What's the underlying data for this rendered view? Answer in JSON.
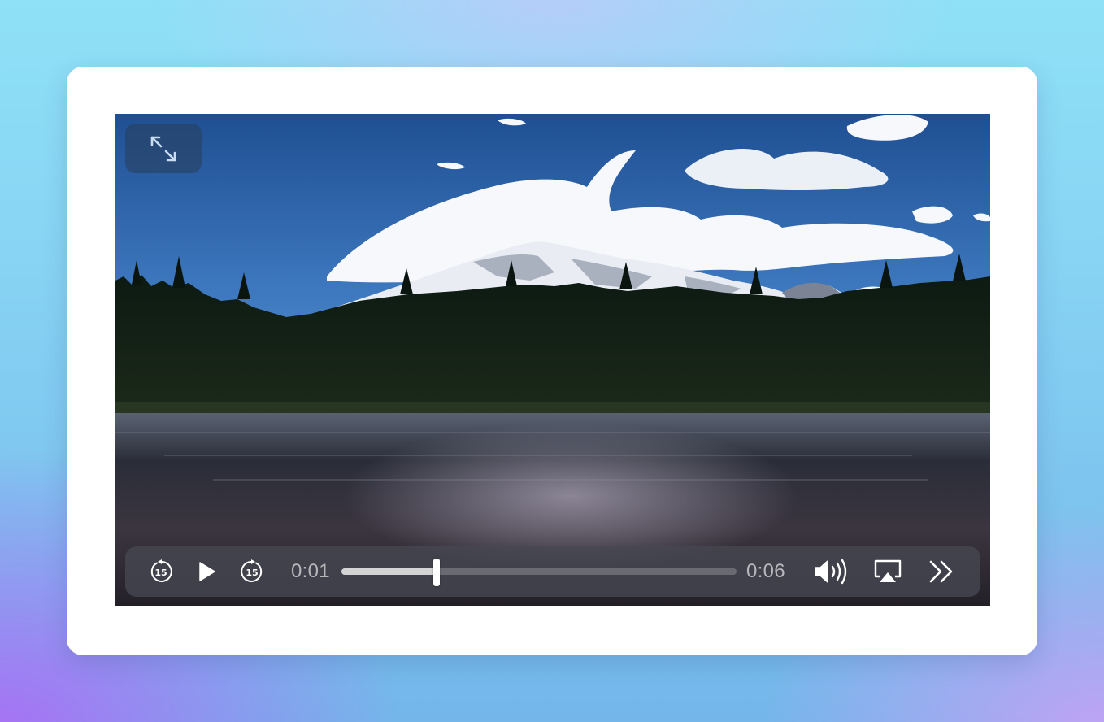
{
  "player": {
    "current_time": "0:01",
    "duration": "0:06",
    "progress_fraction": 0.24,
    "skip_back_seconds": "15",
    "skip_forward_seconds": "15",
    "state": "paused"
  },
  "icons": {
    "fullscreen": "fullscreen-expand-icon",
    "skip_back": "skip-back-15-icon",
    "play": "play-icon",
    "skip_forward": "skip-forward-15-icon",
    "volume": "volume-icon",
    "airplay": "airplay-icon",
    "more": "double-chevron-right-icon"
  },
  "colors": {
    "icon": "#ffffff",
    "time_text": "#bdbdc3",
    "controls_bg": "#4a4c56"
  }
}
